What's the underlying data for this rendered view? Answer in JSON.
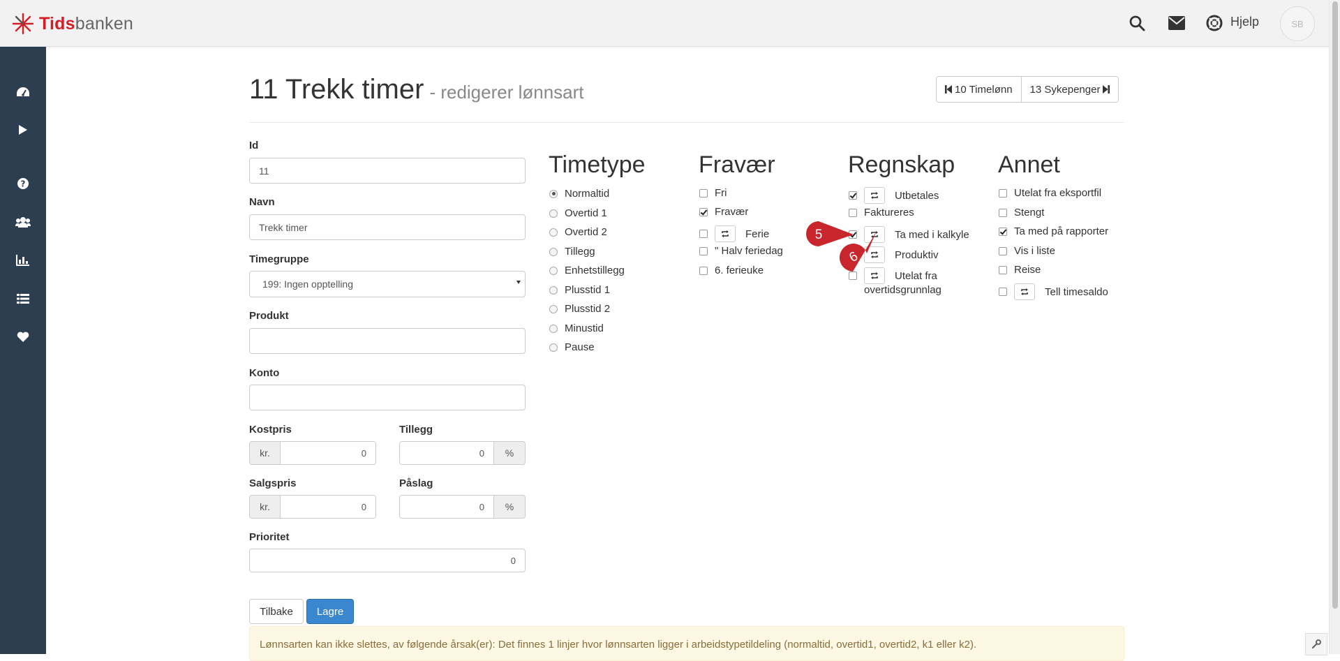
{
  "brand": {
    "part1": "Tids",
    "part2": "banken"
  },
  "topnav": {
    "help_label": "Hjelp",
    "avatar_initials": "SB"
  },
  "sidebar": {
    "items": [
      "dashboard-icon",
      "play-icon",
      "question-icon",
      "users-icon",
      "bar-chart-icon",
      "list-icon",
      "heart-icon"
    ]
  },
  "header": {
    "title": "11 Trekk timer",
    "subtitle": "- redigerer lønnsart",
    "prev_label": "10 Timelønn",
    "next_label": "13 Sykepenger"
  },
  "form": {
    "id_label": "Id",
    "id_value": "11",
    "name_label": "Navn",
    "name_value": "Trekk timer",
    "group_label": "Timegruppe",
    "group_value": "199: Ingen opptelling",
    "product_label": "Produkt",
    "product_value": "",
    "account_label": "Konto",
    "account_value": "",
    "cost_label": "Kostpris",
    "cost_addon": "kr.",
    "cost_value": "0",
    "addition_label": "Tillegg",
    "addition_value": "0",
    "addition_addon": "%",
    "sale_label": "Salgspris",
    "sale_addon": "kr.",
    "sale_value": "0",
    "markup_label": "Påslag",
    "markup_value": "0",
    "markup_addon": "%",
    "priority_label": "Prioritet",
    "priority_value": "0"
  },
  "timetype": {
    "heading": "Timetype",
    "options": [
      "Normaltid",
      "Overtid 1",
      "Overtid 2",
      "Tillegg",
      "Enhetstillegg",
      "Plusstid 1",
      "Plusstid 2",
      "Minustid",
      "Pause"
    ],
    "selected": "Normaltid"
  },
  "fravaer": {
    "heading": "Fravær",
    "items": [
      {
        "label": "Fri",
        "checked": false,
        "sync": false
      },
      {
        "label": "Fravær",
        "checked": true,
        "sync": false
      },
      {
        "label": "Ferie",
        "checked": false,
        "sync": true
      },
      {
        "label": "\" Halv feriedag",
        "checked": false,
        "sync": false
      },
      {
        "label": "6. ferieuke",
        "checked": false,
        "sync": false
      }
    ]
  },
  "regnskap": {
    "heading": "Regnskap",
    "items": [
      {
        "label": "Utbetales",
        "checked": true,
        "sync": true
      },
      {
        "label": "Faktureres",
        "checked": false,
        "sync": false
      },
      {
        "label": "Ta med i kalkyle",
        "checked": true,
        "sync": true
      },
      {
        "label": "Produktiv",
        "checked": false,
        "sync": true
      },
      {
        "label": "Utelat fra",
        "label2": "overtidsgrunnlag",
        "checked": false,
        "sync": true
      }
    ]
  },
  "annet": {
    "heading": "Annet",
    "items": [
      {
        "label": "Utelat fra eksportfil",
        "checked": false,
        "sync": false
      },
      {
        "label": "Stengt",
        "checked": false,
        "sync": false
      },
      {
        "label": "Ta med på rapporter",
        "checked": true,
        "sync": false
      },
      {
        "label": "Vis i liste",
        "checked": false,
        "sync": false
      },
      {
        "label": "Reise",
        "checked": false,
        "sync": false
      },
      {
        "label": "Tell timesaldo",
        "checked": false,
        "sync": true
      }
    ]
  },
  "annotations": {
    "step5": "5",
    "step6": "6"
  },
  "buttons": {
    "back": "Tilbake",
    "save": "Lagre"
  },
  "alert": {
    "text": "Lønnsarten kan ikke slettes, av følgende årsak(er): Det finnes 1 linjer hvor lønnsarten ligger i arbeidstypetildeling (normaltid, overtid1, overtid2, k1 eller k2)."
  },
  "colors": {
    "sidebar": "#2c3e50",
    "brand_red": "#d21f26",
    "primary": "#3a87cf",
    "annotation_red": "#c8252c"
  }
}
